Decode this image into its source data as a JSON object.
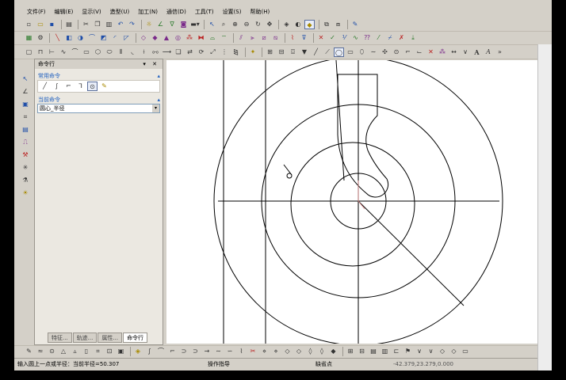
{
  "menu": [
    "文件(F)",
    "编辑(E)",
    "显示(V)",
    "造型(U)",
    "加工(N)",
    "通信(D)",
    "工具(T)",
    "设置(S)",
    "帮助(H)"
  ],
  "toolbar1_icons": [
    "new-icon",
    "open-icon",
    "save-icon",
    "print-icon",
    "cut-icon",
    "copy-icon",
    "paste-icon",
    "undo-icon",
    "redo-icon",
    "sun-icon",
    "style-icon",
    "filter-icon",
    "color-icon",
    "line-style-icon",
    "hatch-icon",
    "select-icon",
    "zoom-window-icon",
    "zoom-in-icon",
    "zoom-dynamic-icon",
    "rotate-view-icon",
    "pan-icon",
    "layer-icon",
    "shade-icon",
    "render-icon",
    "view-icon",
    "view2-icon",
    "pen-icon"
  ],
  "command_panel": {
    "title": "命令行",
    "controls": "▾ ✕",
    "common_header": "常用命令",
    "current_header": "当前命令",
    "command_value": "圆心_半径",
    "tabs": [
      "特征...",
      "轨迹...",
      "属性...",
      "命令行"
    ]
  },
  "status": {
    "prompt": "输入圆上一点或半径：当前半径=50.307",
    "hint": "操作指导",
    "snap": "缺省点",
    "coords": "-42.379,23.279,0.000"
  }
}
